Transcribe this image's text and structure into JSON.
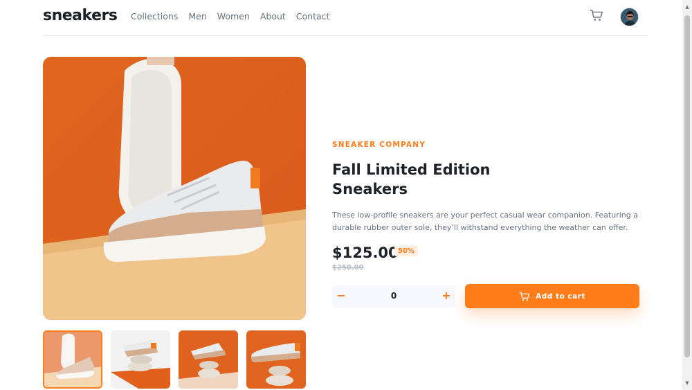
{
  "header": {
    "logo": "sneakers",
    "nav": [
      "Collections",
      "Men",
      "Women",
      "About",
      "Contact"
    ],
    "cart_icon": "cart-icon",
    "avatar_icon": "user-avatar"
  },
  "product": {
    "company": "SNEAKER COMPANY",
    "title_line1": "Fall Limited Edition",
    "title_line2": "Sneakers",
    "description": "These low-profile sneakers are your perfect casual wear companion. Featuring a durable rubber outer sole, they’ll withstand everything the weather can offer.",
    "price": "$125.00",
    "discount": "50%",
    "old_price": "$250.00",
    "quantity": "0",
    "minus_label": "−",
    "plus_label": "+",
    "add_to_cart": "Add to cart"
  },
  "gallery": {
    "selected_index": 0,
    "thumbnail_count": 4
  },
  "colors": {
    "accent": "#ff7d1a",
    "accent_pale": "#ffede0",
    "text_dark": "#1d2026",
    "text_muted": "#69707d"
  }
}
